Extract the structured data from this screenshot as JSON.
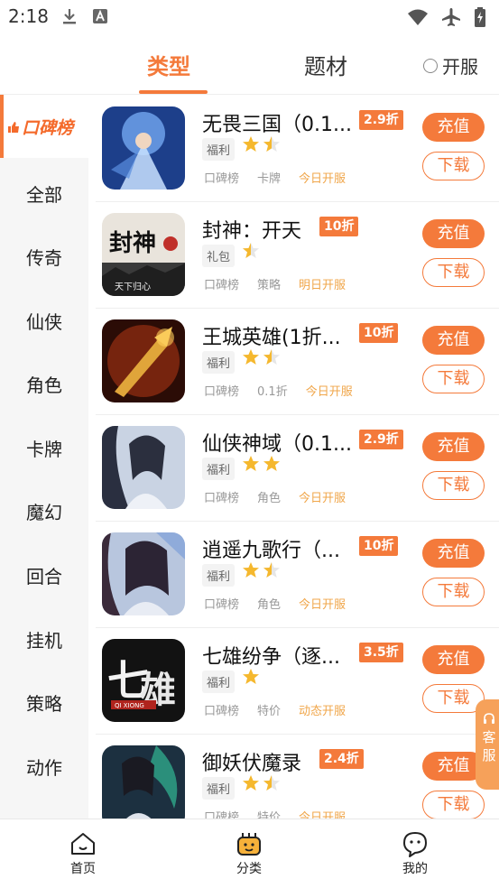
{
  "status_bar": {
    "time": "2:18",
    "icons": [
      "download-icon",
      "a-square-icon",
      "wifi-icon",
      "airplane-icon",
      "battery-icon"
    ]
  },
  "top_tabs": {
    "type_label": "类型",
    "theme_label": "题材",
    "kaifu_label": "开服"
  },
  "sidebar": {
    "active_label": "口碑榜",
    "items": [
      "全部",
      "传奇",
      "仙侠",
      "角色",
      "卡牌",
      "魔幻",
      "回合",
      "挂机",
      "策略",
      "动作"
    ]
  },
  "games": [
    {
      "title": "无畏三国（0.1...",
      "discount": "2.9折",
      "tag": "福利",
      "stars": 1.5,
      "meta": [
        "口碑榜",
        "卡牌",
        "今日开服"
      ]
    },
    {
      "title": "封神：开天",
      "discount": "10折",
      "tag": "礼包",
      "stars": 0.5,
      "meta": [
        "口碑榜",
        "策略",
        "明日开服"
      ]
    },
    {
      "title": "王城英雄(1折...",
      "discount": "10折",
      "tag": "福利",
      "stars": 1.5,
      "meta": [
        "口碑榜",
        "0.1折",
        "今日开服"
      ]
    },
    {
      "title": "仙侠神域（0.1...",
      "discount": "2.9折",
      "tag": "福利",
      "stars": 2,
      "meta": [
        "口碑榜",
        "角色",
        "今日开服"
      ]
    },
    {
      "title": "逍遥九歌行（...",
      "discount": "10折",
      "tag": "福利",
      "stars": 1.5,
      "meta": [
        "口碑榜",
        "角色",
        "今日开服"
      ]
    },
    {
      "title": "七雄纷争（逐...",
      "discount": "3.5折",
      "tag": "福利",
      "stars": 1,
      "meta": [
        "口碑榜",
        "特价",
        "动态开服"
      ]
    },
    {
      "title": "御妖伏魔录",
      "discount": "2.4折",
      "tag": "福利",
      "stars": 1.5,
      "meta": [
        "口碑榜",
        "特价",
        "今日开服"
      ]
    }
  ],
  "buttons": {
    "charge": "充值",
    "download": "下载"
  },
  "service": {
    "label": "客服"
  },
  "bottom_nav": {
    "home": "首页",
    "category": "分类",
    "mine": "我的"
  },
  "colors": {
    "accent": "#f47a3b",
    "star": "#f5b82e",
    "open_text": "#f0a64a"
  }
}
